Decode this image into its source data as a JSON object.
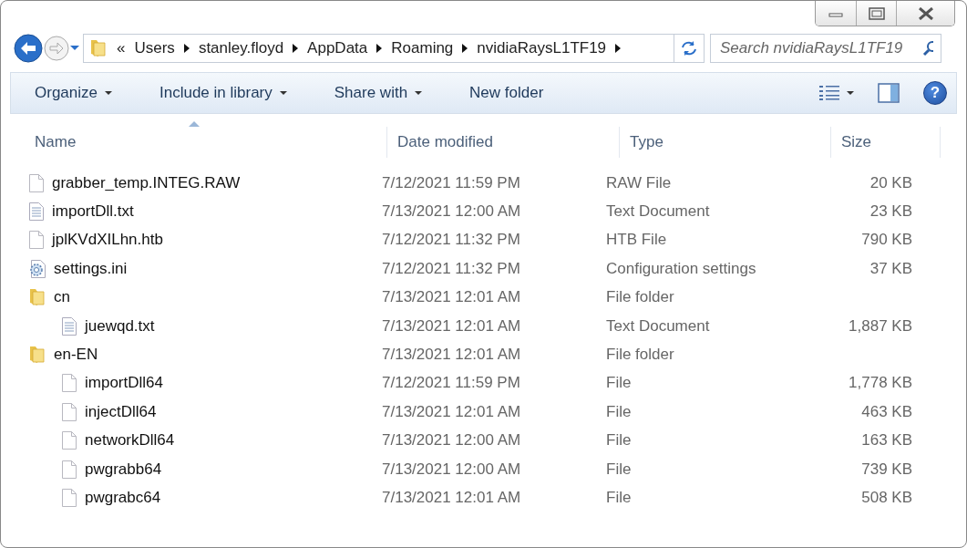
{
  "address_bar": {
    "overflow": "«",
    "breadcrumbs": [
      "Users",
      "stanley.floyd",
      "AppData",
      "Roaming",
      "nvidiaRaysL1TF19"
    ]
  },
  "help": {
    "label": "?"
  },
  "search": {
    "placeholder": "Search nvidiaRaysL1TF19"
  },
  "toolbar": {
    "menus": [
      {
        "label": "Organize",
        "dropdown": true
      },
      {
        "label": "Include in library",
        "dropdown": true
      },
      {
        "label": "Share with",
        "dropdown": true
      },
      {
        "label": "New folder",
        "dropdown": false
      }
    ]
  },
  "table": {
    "columns": [
      "Name",
      "Date modified",
      "Type",
      "Size"
    ],
    "rows": [
      {
        "kind": "file",
        "name": "grabber_temp.INTEG.RAW",
        "date": "7/12/2021 11:59 PM",
        "type": "RAW File",
        "size": "20 KB"
      },
      {
        "kind": "text",
        "name": "importDll.txt",
        "date": "7/13/2021 12:00 AM",
        "type": "Text Document",
        "size": "23 KB"
      },
      {
        "kind": "file",
        "name": "jplKVdXILhn.htb",
        "date": "7/12/2021 11:32 PM",
        "type": "HTB File",
        "size": "790 KB"
      },
      {
        "kind": "config",
        "name": "settings.ini",
        "date": "7/12/2021 11:32 PM",
        "type": "Configuration settings",
        "size": "37 KB"
      },
      {
        "kind": "folder",
        "name": "cn",
        "date": "7/13/2021 12:01 AM",
        "type": "File folder",
        "children": [
          {
            "kind": "text",
            "name": "juewqd.txt",
            "date": "7/13/2021 12:01 AM",
            "type": "Text Document",
            "size": "1,887 KB"
          }
        ]
      },
      {
        "kind": "folder",
        "name": "en-EN",
        "date": "7/13/2021 12:01 AM",
        "type": "File folder",
        "children": [
          {
            "kind": "file",
            "name": "importDll64",
            "date": "7/12/2021 11:59 PM",
            "type": "File",
            "size": "1,778 KB"
          },
          {
            "kind": "file",
            "name": "injectDll64",
            "date": "7/13/2021 12:01 AM",
            "type": "File",
            "size": "463 KB"
          },
          {
            "kind": "file",
            "name": "networkDll64",
            "date": "7/13/2021 12:00 AM",
            "type": "File",
            "size": "163 KB"
          },
          {
            "kind": "file",
            "name": "pwgrabb64",
            "date": "7/13/2021 12:00 AM",
            "type": "File",
            "size": "739 KB"
          },
          {
            "kind": "file",
            "name": "pwgrabc64",
            "date": "7/13/2021 12:01 AM",
            "type": "File",
            "size": "508 KB"
          }
        ]
      }
    ]
  }
}
